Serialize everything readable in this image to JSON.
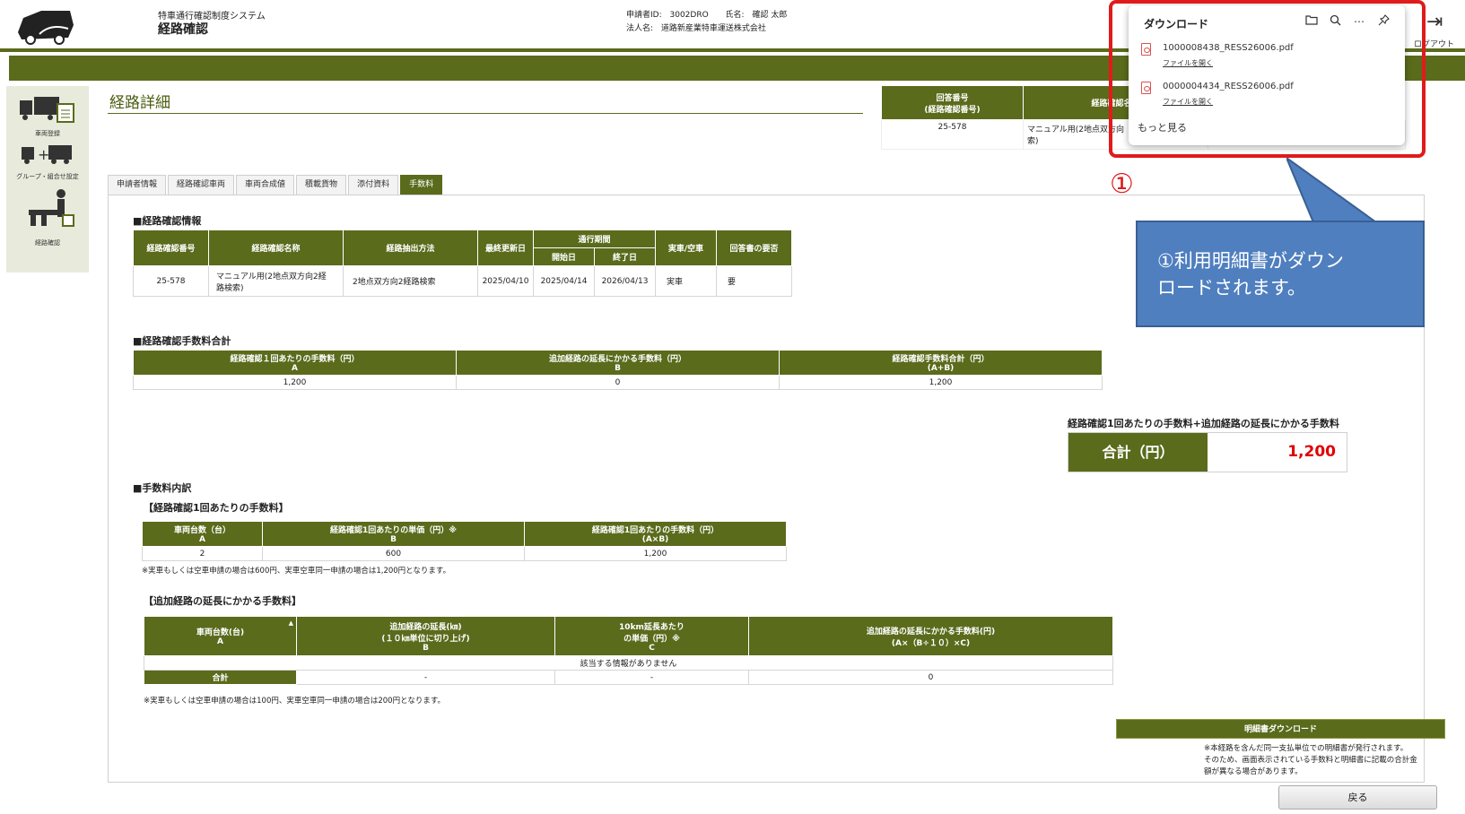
{
  "header": {
    "system_name": "特車通行確認制度システム",
    "screen_name": "経路確認",
    "applicant_id_label": "申請者ID:",
    "applicant_id": "3002DRO",
    "name_label": "氏名:",
    "name": "確認 太郎",
    "corp_label": "法人名:",
    "corp": "道路新産業特車運送株式会社",
    "logout": "ログアウト"
  },
  "sidebar": {
    "items": [
      {
        "label": "車両登録"
      },
      {
        "label": "グループ・組合せ設定"
      },
      {
        "label": "経路確認"
      }
    ]
  },
  "page_title": "経路詳細",
  "answer_table": {
    "headers": [
      "回答番号\n(経路確認番号)",
      "経路確認名称"
    ],
    "header_1a": "回答番号",
    "header_1b": "(経路確認番号)",
    "header_2": "経路確認名称",
    "row": [
      "25-578",
      "マニュアル用(2地点双方向2経路検索)"
    ],
    "row_name_line1": "マニュアル用(2地点双方向",
    "row_name_line2": "索)"
  },
  "tabs": [
    {
      "label": "申請者情報",
      "active": false
    },
    {
      "label": "経路確認車両",
      "active": false
    },
    {
      "label": "車両合成値",
      "active": false
    },
    {
      "label": "積載貨物",
      "active": false
    },
    {
      "label": "添付資料",
      "active": false
    },
    {
      "label": "手数料",
      "active": true
    }
  ],
  "route_info": {
    "section_title": "■経路確認情報",
    "headers": {
      "number": "経路確認番号",
      "name": "経路確認名称",
      "method": "経路抽出方法",
      "updated": "最終更新日",
      "period": "通行期間",
      "start": "開始日",
      "end": "終了日",
      "load": "実車/空車",
      "need": "回答書の要否"
    },
    "row": {
      "number": "25-578",
      "name_line1": "マニュアル用(2地点双方向2経",
      "name_line2": "路検索)",
      "method": "2地点双方向2経路検索",
      "updated": "2025/04/10",
      "start": "2025/04/14",
      "end": "2026/04/13",
      "load": "実車",
      "need": "要"
    }
  },
  "fee_total": {
    "section_title": "■経路確認手数料合計",
    "headers": [
      {
        "l1": "経路確認１回あたりの手数料（円）",
        "l2": "A"
      },
      {
        "l1": "追加経路の延長にかかる手数料（円）",
        "l2": "B"
      },
      {
        "l1": "経路確認手数料合計（円）",
        "l2": "(A+B)"
      }
    ],
    "values": [
      "1,200",
      "0",
      "1,200"
    ]
  },
  "grand_total": {
    "caption": "経路確認1回あたりの手数料+追加経路の延長にかかる手数料",
    "label": "合計（円）",
    "value": "1,200"
  },
  "breakdown": {
    "section_title": "■手数料内訳",
    "per_route": {
      "title": "【経路確認1回あたりの手数料】",
      "headers": [
        {
          "l1": "車両台数（台）",
          "l2": "A"
        },
        {
          "l1": "経路確認1回あたりの単価（円）※",
          "l2": "B"
        },
        {
          "l1": "経路確認1回あたりの手数料（円）",
          "l2": "(A×B)"
        }
      ],
      "values": [
        "2",
        "600",
        "1,200"
      ],
      "note": "※実車もしくは空車申請の場合は600円、実車空車同一申請の場合は1,200円となります。"
    },
    "extension": {
      "title": "【追加経路の延長にかかる手数料】",
      "headers": [
        {
          "l1": "車両台数(台)",
          "l2": "",
          "l3": "A"
        },
        {
          "l1": "追加経路の延長(㎞)",
          "l2": "(１０㎞単位に切り上げ)",
          "l3": "B"
        },
        {
          "l1": "10km延長あたり",
          "l2": "の単価（円）※",
          "l3": "C"
        },
        {
          "l1": "追加経路の延長にかかる手数料(円)",
          "l2": "(A×（B÷１０）×C)",
          "l3": ""
        }
      ],
      "empty_message": "該当する情報がありません",
      "total_label": "合計",
      "total_values": [
        "-",
        "-",
        "0"
      ],
      "note": "※実車もしくは空車申請の場合は100円、実車空車同一申請の場合は200円となります。"
    }
  },
  "download_button": "明細書ダウンロード",
  "download_note": [
    "※本経路を含んだ同一支払単位での明細書が発行されます。",
    "そのため、画面表示されている手数料と明細書に記載の合計金",
    "額が異なる場合があります。"
  ],
  "back_button": "戻る",
  "download_popup": {
    "title": "ダウンロード",
    "items": [
      {
        "file": "1000008438_RESS26006.pdf",
        "action": "ファイルを開く"
      },
      {
        "file": "0000004434_RESS26006.pdf",
        "action": "ファイルを開く"
      }
    ],
    "more": "もっと見る"
  },
  "annotation": {
    "marker": "①",
    "callout_line1": "①利用明細書がダウン",
    "callout_line2": "ロードされます。",
    "frame_color": "#e01b1b",
    "callout_color": "#4f7fbf"
  },
  "colors": {
    "brand_green": "#5a6b1c",
    "total_red": "#e00000"
  }
}
